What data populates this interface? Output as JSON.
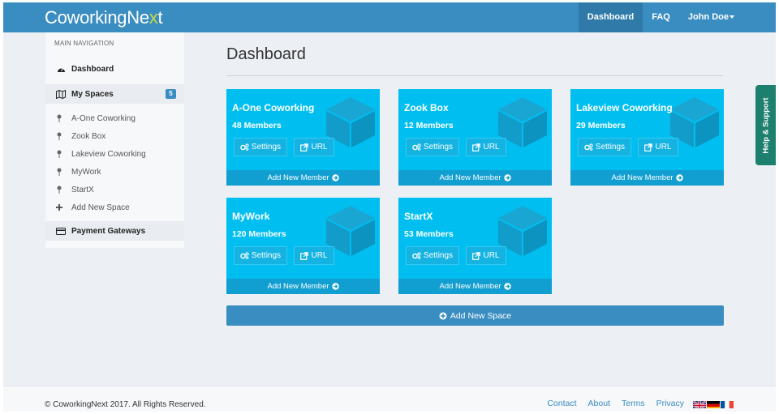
{
  "navbar": {
    "brand_main": "CoworkingNe",
    "brand_accent": "x",
    "brand_end": "t",
    "links": [
      {
        "label": "Dashboard"
      },
      {
        "label": "FAQ"
      },
      {
        "label": "John Doe"
      }
    ]
  },
  "sidebar": {
    "heading": "MAIN NAVIGATION",
    "dashboard": "Dashboard",
    "my_spaces": "My Spaces",
    "spaces_count": "5",
    "spaces": [
      "A-One Coworking",
      "Zook Box",
      "Lakeview Coworking",
      "MyWork",
      "StartX"
    ],
    "add_space": "Add New Space",
    "payment": "Payment Gateways"
  },
  "main": {
    "title": "Dashboard",
    "cards": [
      {
        "name": "A-One Coworking",
        "members": "48 Members"
      },
      {
        "name": "Zook Box",
        "members": "12 Members"
      },
      {
        "name": "Lakeview Coworking",
        "members": "29 Members"
      },
      {
        "name": "MyWork",
        "members": "120 Members"
      },
      {
        "name": "StartX",
        "members": "53 Members"
      }
    ],
    "settings_label": "Settings",
    "url_label": "URL",
    "add_member_label": "Add New Member",
    "add_space_label": "Add New Space"
  },
  "help_tab": "Help & Support",
  "footer": {
    "copyright": "© CoworkingNext 2017. All Rights Reserved.",
    "links": [
      "Contact",
      "About",
      "Terms",
      "Privacy"
    ]
  },
  "colors": {
    "navbar": "#3a8dc1",
    "card": "#00bff0",
    "card_footer": "#119ed0",
    "help_tab": "#1d7f6e"
  }
}
